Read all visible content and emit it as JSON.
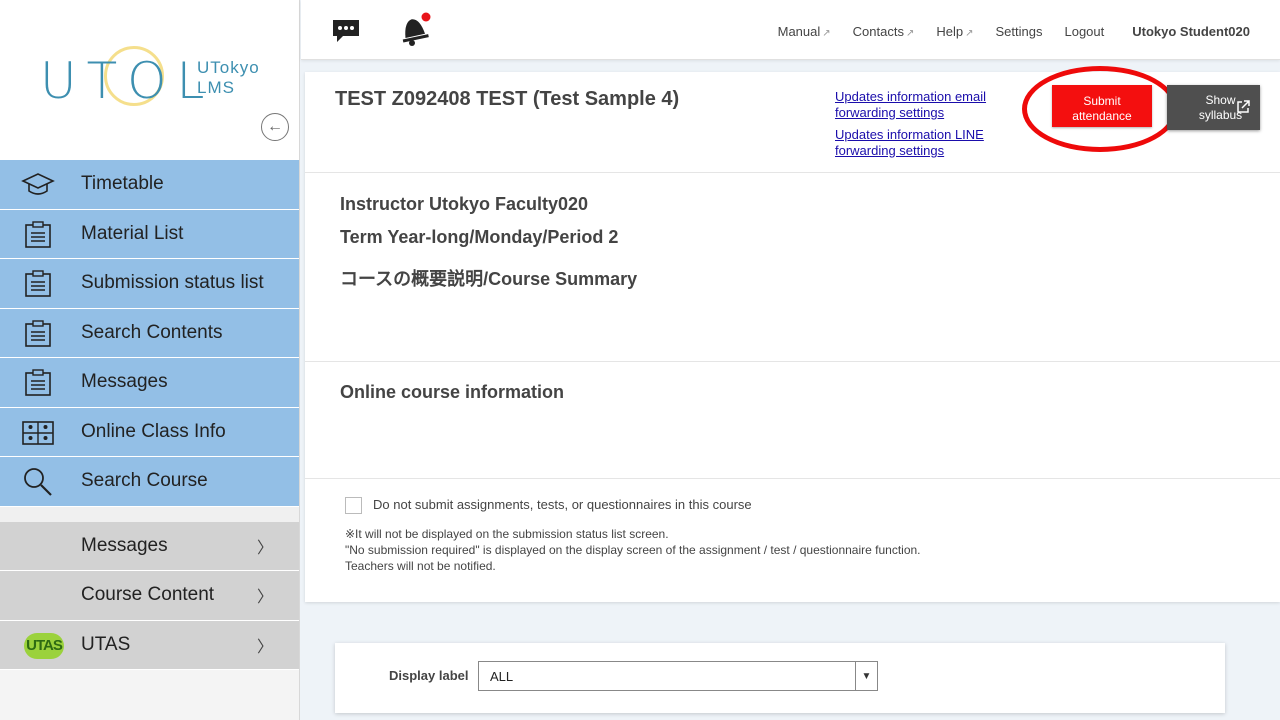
{
  "sidebar": {
    "logo": {
      "main": "UTOL",
      "sub_line1": "UTokyo",
      "sub_line2": "LMS"
    },
    "primary_items": [
      {
        "label": "Timetable",
        "icon": "graduation-cap-icon"
      },
      {
        "label": "Material List",
        "icon": "clipboard-icon"
      },
      {
        "label": "Submission status list",
        "icon": "clipboard-icon"
      },
      {
        "label": "Search Contents",
        "icon": "clipboard-icon"
      },
      {
        "label": "Messages",
        "icon": "clipboard-icon"
      },
      {
        "label": "Online Class Info",
        "icon": "video-grid-icon"
      },
      {
        "label": "Search Course",
        "icon": "magnifier-icon"
      }
    ],
    "secondary_items": [
      {
        "label": "Messages",
        "chevron": "〉"
      },
      {
        "label": "Course Content",
        "chevron": "〉"
      },
      {
        "label": "UTAS",
        "chevron": "〉",
        "logo_text": "UTAS"
      }
    ]
  },
  "header": {
    "links": {
      "manual": "Manual",
      "contacts": "Contacts",
      "help": "Help",
      "settings": "Settings",
      "logout": "Logout"
    },
    "user": "Utokyo Student020",
    "notification_dot_color": "#e8141a"
  },
  "course": {
    "title": "TEST Z092408 TEST (Test Sample 4)",
    "email_link_line1": "Updates information email",
    "email_link_line2": "forwarding settings",
    "line_link_line1": "Updates information LINE",
    "line_link_line2": "forwarding settings",
    "attend_button_line1": "Submit",
    "attend_button_line2": "attendance",
    "syllabus_button_line1": "Show",
    "syllabus_button_line2": "syllabus",
    "instructor": "Instructor Utokyo Faculty020",
    "term": "Term Year-long/Monday/Period 2",
    "summary_heading": "コースの概要説明/Course Summary",
    "online_heading": "Online course information",
    "no_submit_label": "Do not submit assignments, tests, or questionnaires in this course",
    "note_line1": "※It will not be displayed on the submission status list screen.",
    "note_line2": "\"No submission required\" is displayed on the display screen of the assignment / test / questionnaire function.",
    "note_line3": "Teachers will not be notified."
  },
  "filter": {
    "label": "Display label",
    "selected": "ALL"
  },
  "colors": {
    "nav_blue": "#93bfe6",
    "nav_gray": "#d2d2d2",
    "attend_red": "#f40f0f",
    "syllabus_dark": "#4f4f4f"
  }
}
